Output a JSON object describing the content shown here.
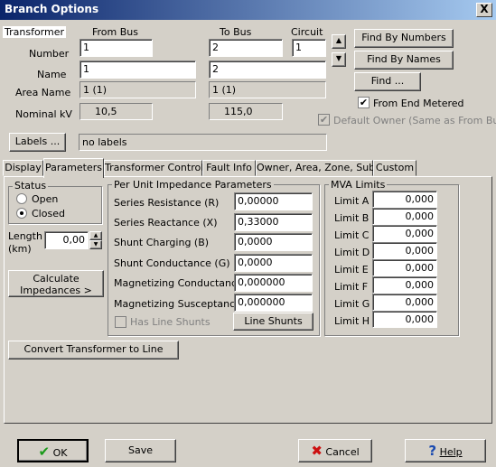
{
  "window": {
    "title": "Branch Options",
    "close": "X"
  },
  "header": {
    "transformer_label": "Transformer",
    "from_bus_label": "From Bus",
    "to_bus_label": "To Bus",
    "circuit_label": "Circuit",
    "number_label": "Number",
    "name_label": "Name",
    "area_label": "Area Name",
    "kv_label": "Nominal kV",
    "from_number": "1",
    "to_number": "2",
    "circuit": "1",
    "from_name": "1",
    "to_name": "2",
    "from_area": "1 (1)",
    "to_area": "1 (1)",
    "from_kv": "10,5",
    "to_kv": "115,0",
    "labels_button": "Labels ...",
    "labels_value": "no labels",
    "find_by_numbers": "Find By Numbers",
    "find_by_names": "Find By Names",
    "find": "Find ...",
    "from_end_metered": "From End Metered",
    "default_owner": "Default Owner (Same as From Bus)"
  },
  "tabs": [
    "Display",
    "Parameters",
    "Transformer Control",
    "Fault Info",
    "Owner, Area, Zone, Sub",
    "Custom"
  ],
  "status": {
    "title": "Status",
    "open": "Open",
    "closed": "Closed",
    "length_label": "Length (km)",
    "length_value": "0,00",
    "calc_button": "Calculate Impedances >"
  },
  "impedance": {
    "title": "Per Unit Impedance Parameters",
    "rows": [
      {
        "label": "Series Resistance (R)",
        "value": "0,00000"
      },
      {
        "label": "Series Reactance (X)",
        "value": "0,33000"
      },
      {
        "label": "Shunt Charging (B)",
        "value": "0,0000"
      },
      {
        "label": "Shunt Conductance (G)",
        "value": "0,0000"
      },
      {
        "label": "Magnetizing Conductance",
        "value": "0,000000"
      },
      {
        "label": "Magnetizing Susceptance",
        "value": "0,000000"
      }
    ],
    "has_line_shunts": "Has Line Shunts",
    "line_shunts_button": "Line Shunts"
  },
  "mva": {
    "title": "MVA Limits",
    "limits": [
      {
        "label": "Limit A",
        "value": "0,000"
      },
      {
        "label": "Limit B",
        "value": "0,000"
      },
      {
        "label": "Limit C",
        "value": "0,000"
      },
      {
        "label": "Limit D",
        "value": "0,000"
      },
      {
        "label": "Limit E",
        "value": "0,000"
      },
      {
        "label": "Limit F",
        "value": "0,000"
      },
      {
        "label": "Limit G",
        "value": "0,000"
      },
      {
        "label": "Limit H",
        "value": "0,000"
      }
    ]
  },
  "convert_button": "Convert Transformer to Line",
  "footer": {
    "ok": "OK",
    "save": "Save",
    "cancel": "Cancel",
    "help": "Help"
  },
  "colors": {
    "title_start": "#0a246a",
    "title_end": "#a6caf0",
    "face": "#d4d0c8",
    "ok_icon": "#1a9a1a",
    "cancel_icon": "#cc1010",
    "help_icon": "#1a4ab0"
  }
}
